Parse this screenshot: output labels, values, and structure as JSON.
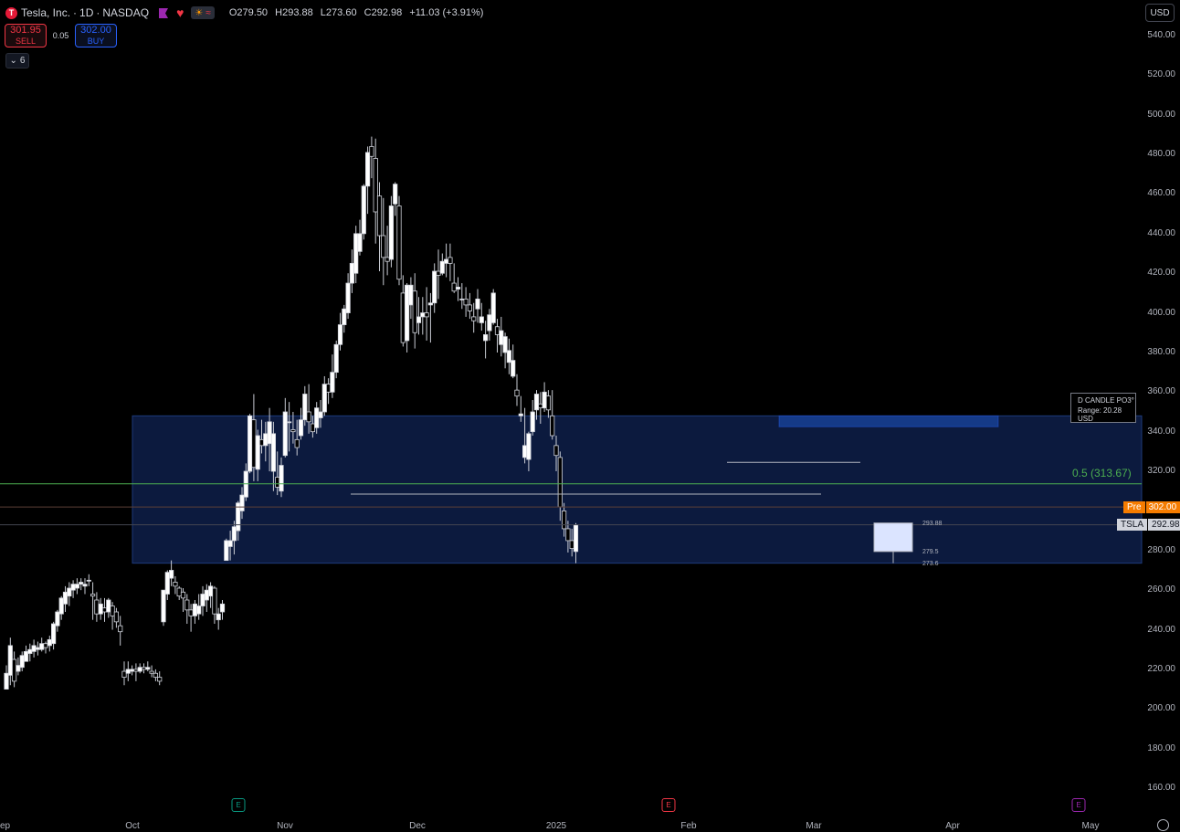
{
  "symbol": {
    "name": "Tesla, Inc.",
    "interval": "1D",
    "exchange": "NASDAQ",
    "logo": "T"
  },
  "ohlc": {
    "o_label": "O",
    "o": "279.50",
    "h_label": "H",
    "h": "293.88",
    "l_label": "L",
    "l": "273.60",
    "c_label": "C",
    "c": "292.98",
    "change": "+11.03 (+3.91%)"
  },
  "trade": {
    "sell_price": "301.95",
    "sell_label": "SELL",
    "spread": "0.05",
    "buy_price": "302.00",
    "buy_label": "BUY"
  },
  "indicators_collapsed": {
    "count": "6",
    "chevron": "chevron-down-icon"
  },
  "currency": "USD",
  "price_axis": [
    {
      "label": "540.00",
      "v": 540
    },
    {
      "label": "520.00",
      "v": 520
    },
    {
      "label": "500.00",
      "v": 500
    },
    {
      "label": "480.00",
      "v": 480
    },
    {
      "label": "460.00",
      "v": 460
    },
    {
      "label": "440.00",
      "v": 440
    },
    {
      "label": "420.00",
      "v": 420
    },
    {
      "label": "400.00",
      "v": 400
    },
    {
      "label": "380.00",
      "v": 380
    },
    {
      "label": "360.00",
      "v": 360
    },
    {
      "label": "340.00",
      "v": 340
    },
    {
      "label": "320.00",
      "v": 320
    },
    {
      "label": "280.00",
      "v": 280
    },
    {
      "label": "260.00",
      "v": 260
    },
    {
      "label": "240.00",
      "v": 240
    },
    {
      "label": "220.00",
      "v": 220
    },
    {
      "label": "200.00",
      "v": 200
    },
    {
      "label": "180.00",
      "v": 180
    },
    {
      "label": "160.00",
      "v": 160
    }
  ],
  "time_axis": [
    "ep",
    "Oct",
    "Nov",
    "Dec",
    "2025",
    "Feb",
    "Mar",
    "Apr",
    "May"
  ],
  "earnings_badges": [
    {
      "letter": "E",
      "color": "#089981"
    },
    {
      "letter": "E",
      "color": "#f23645"
    },
    {
      "letter": "E",
      "color": "#9c27b0"
    }
  ],
  "price_tags": {
    "pre_label": "Pre",
    "pre_price": "302.00",
    "pre_color": "#f57c00",
    "symbol_label": "TSLA",
    "last_price": "292.98"
  },
  "drawings": {
    "info_title": "D CANDLE PO3°",
    "info_range": "Range: 20.28 USD",
    "fib_label": "0.5 (313.67)",
    "fib_value": 313.67,
    "zone_top": 348,
    "zone_bottom": 273.6,
    "projection_labels": [
      "293.88",
      "279.5",
      "273.6"
    ]
  },
  "chart_data": {
    "type": "candlestick",
    "ylim": [
      155,
      545
    ],
    "candles": [
      [
        210,
        222,
        210,
        218
      ],
      [
        217,
        236,
        212,
        232
      ],
      [
        225,
        229,
        211,
        214
      ],
      [
        219,
        226,
        217,
        222
      ],
      [
        221,
        229,
        219,
        227
      ],
      [
        224,
        232,
        224,
        229
      ],
      [
        228,
        233,
        224,
        230
      ],
      [
        229,
        235,
        226,
        232
      ],
      [
        230,
        234,
        227,
        231
      ],
      [
        230,
        236,
        229,
        233
      ],
      [
        233,
        234,
        228,
        231
      ],
      [
        232,
        237,
        229,
        235
      ],
      [
        233,
        244,
        230,
        243
      ],
      [
        242,
        250,
        239,
        249
      ],
      [
        248,
        257,
        245,
        256
      ],
      [
        253,
        262,
        249,
        259
      ],
      [
        257,
        264,
        252,
        261
      ],
      [
        260,
        265,
        256,
        263
      ],
      [
        261,
        266,
        258,
        263
      ],
      [
        263,
        266,
        260,
        264
      ],
      [
        262,
        266,
        258,
        263
      ],
      [
        265,
        268,
        262,
        265
      ],
      [
        258,
        264,
        245,
        257
      ],
      [
        255,
        259,
        244,
        248
      ],
      [
        248,
        256,
        245,
        253
      ],
      [
        251,
        256,
        244,
        249
      ],
      [
        249,
        256,
        246,
        255
      ],
      [
        252,
        254,
        240,
        247
      ],
      [
        249,
        251,
        241,
        244
      ],
      [
        242,
        247,
        232,
        239
      ],
      [
        219,
        224,
        212,
        216
      ],
      [
        218,
        224,
        214,
        220
      ],
      [
        219,
        222,
        217,
        220
      ],
      [
        220,
        223,
        214,
        219
      ],
      [
        219,
        223,
        218,
        221
      ],
      [
        221,
        223,
        218,
        220
      ],
      [
        220,
        224,
        219,
        221
      ],
      [
        219,
        222,
        216,
        218
      ],
      [
        218,
        220,
        214,
        216
      ],
      [
        216,
        219,
        212,
        214
      ],
      [
        244,
        260,
        242,
        260
      ],
      [
        258,
        270,
        255,
        269
      ],
      [
        266,
        275,
        262,
        270
      ],
      [
        264,
        267,
        258,
        262
      ],
      [
        261,
        262,
        255,
        257
      ],
      [
        259,
        261,
        249,
        256
      ],
      [
        255,
        258,
        243,
        250
      ],
      [
        250,
        253,
        239,
        247
      ],
      [
        247,
        255,
        243,
        253
      ],
      [
        248,
        258,
        245,
        252
      ],
      [
        252,
        262,
        247,
        258
      ],
      [
        255,
        263,
        249,
        260
      ],
      [
        257,
        264,
        251,
        262
      ],
      [
        261,
        262,
        243,
        248
      ],
      [
        245,
        251,
        240,
        248
      ],
      [
        249,
        255,
        245,
        253
      ],
      [
        275,
        286,
        275,
        285
      ],
      [
        282,
        290,
        275,
        285
      ],
      [
        285,
        295,
        278,
        292
      ],
      [
        290,
        305,
        285,
        304
      ],
      [
        300,
        312,
        296,
        308
      ],
      [
        307,
        324,
        305,
        320
      ],
      [
        320,
        349,
        319,
        348
      ],
      [
        346,
        359,
        315,
        322
      ],
      [
        321,
        341,
        315,
        338
      ],
      [
        336,
        346,
        329,
        333
      ],
      [
        333,
        345,
        325,
        339
      ],
      [
        334,
        352,
        320,
        345
      ],
      [
        320,
        345,
        310,
        339
      ],
      [
        317,
        330,
        308,
        312
      ],
      [
        310,
        327,
        307,
        323
      ],
      [
        328,
        357,
        327,
        350
      ],
      [
        345,
        355,
        330,
        345
      ],
      [
        341,
        350,
        334,
        340
      ],
      [
        336,
        346,
        328,
        332
      ],
      [
        338,
        352,
        336,
        346
      ],
      [
        346,
        363,
        343,
        359
      ],
      [
        350,
        364,
        339,
        345
      ],
      [
        344,
        348,
        337,
        340
      ],
      [
        342,
        355,
        339,
        352
      ],
      [
        347,
        356,
        342,
        350
      ],
      [
        350,
        368,
        348,
        364
      ],
      [
        364,
        367,
        354,
        360
      ],
      [
        360,
        379,
        357,
        370
      ],
      [
        370,
        386,
        367,
        384
      ],
      [
        384,
        400,
        381,
        394
      ],
      [
        394,
        404,
        390,
        402
      ],
      [
        400,
        420,
        397,
        415
      ],
      [
        415,
        432,
        410,
        425
      ],
      [
        420,
        444,
        415,
        440
      ],
      [
        431,
        447,
        429,
        440
      ],
      [
        440,
        465,
        437,
        464
      ],
      [
        464,
        484,
        450,
        481
      ],
      [
        484,
        489,
        468,
        479
      ],
      [
        478,
        488,
        435,
        451
      ],
      [
        459,
        466,
        421,
        439
      ],
      [
        439,
        458,
        414,
        428
      ],
      [
        428,
        444,
        419,
        426
      ],
      [
        427,
        459,
        423,
        454
      ],
      [
        455,
        466,
        449,
        465
      ],
      [
        454,
        459,
        414,
        417
      ],
      [
        410,
        419,
        383,
        385
      ],
      [
        386,
        415,
        380,
        414
      ],
      [
        404,
        418,
        397,
        414
      ],
      [
        411,
        420,
        382,
        390
      ],
      [
        395,
        408,
        389,
        398
      ],
      [
        398,
        408,
        389,
        400
      ],
      [
        400,
        413,
        386,
        398
      ],
      [
        404,
        410,
        385,
        405
      ],
      [
        405,
        425,
        400,
        421
      ],
      [
        421,
        432,
        407,
        419
      ],
      [
        420,
        430,
        419,
        426
      ],
      [
        425,
        435,
        418,
        427
      ],
      [
        428,
        435,
        416,
        425
      ],
      [
        415,
        425,
        410,
        411
      ],
      [
        412,
        418,
        406,
        413
      ],
      [
        407,
        415,
        402,
        407
      ],
      [
        407,
        413,
        398,
        404
      ],
      [
        404,
        410,
        397,
        401
      ],
      [
        398,
        405,
        390,
        396
      ],
      [
        402,
        412,
        395,
        407
      ],
      [
        395,
        405,
        391,
        398
      ],
      [
        386,
        396,
        377,
        389
      ],
      [
        391,
        402,
        386,
        399
      ],
      [
        395,
        412,
        394,
        410
      ],
      [
        393,
        397,
        380,
        389
      ],
      [
        384,
        398,
        378,
        391
      ],
      [
        380,
        390,
        372,
        388
      ],
      [
        375,
        387,
        369,
        381
      ],
      [
        368,
        384,
        367,
        376
      ],
      [
        361,
        369,
        353,
        358
      ],
      [
        348,
        358,
        345,
        349
      ],
      [
        327,
        352,
        324,
        333
      ],
      [
        326,
        340,
        320,
        339
      ],
      [
        340,
        356,
        338,
        350
      ],
      [
        351,
        361,
        346,
        359
      ],
      [
        354,
        360,
        344,
        352
      ],
      [
        352,
        365,
        350,
        360
      ],
      [
        358,
        361,
        347,
        351
      ],
      [
        348,
        361,
        336,
        338
      ],
      [
        333,
        338,
        320,
        328
      ],
      [
        327,
        330,
        295,
        302
      ],
      [
        300,
        304,
        287,
        291
      ],
      [
        291,
        295,
        279,
        285
      ],
      [
        285,
        291,
        277,
        281
      ],
      [
        279.5,
        293.88,
        273.6,
        292.98
      ]
    ]
  }
}
